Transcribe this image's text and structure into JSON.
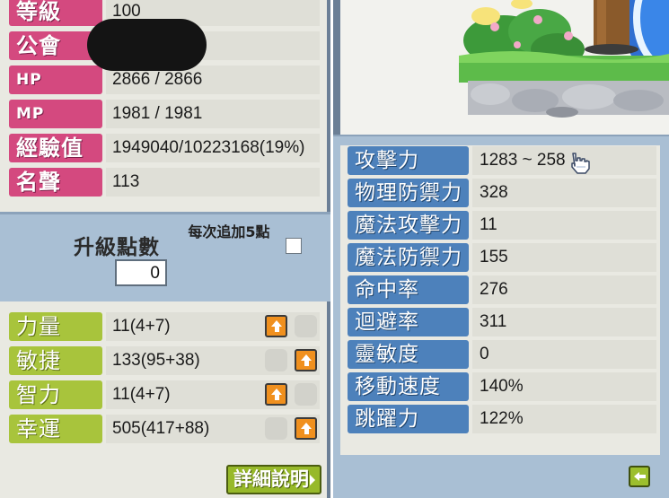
{
  "basic_stats": [
    {
      "label": "等級",
      "value": "100"
    },
    {
      "label": "公會",
      "value": ""
    },
    {
      "label": "HP",
      "value": "2866 / 2866"
    },
    {
      "label": "MP",
      "value": "1981 / 1981"
    },
    {
      "label": "經驗值",
      "value": "1949040/10223168(19%)"
    },
    {
      "label": "名聲",
      "value": "113"
    }
  ],
  "ability_points": {
    "title": "升級點數",
    "value": "0",
    "each_add_label": "每次追加5點"
  },
  "main_stats": [
    {
      "label": "力量",
      "value": "11(4+7)"
    },
    {
      "label": "敏捷",
      "value": "133(95+38)"
    },
    {
      "label": "智力",
      "value": "11(4+7)"
    },
    {
      "label": "幸運",
      "value": "505(417+88)"
    }
  ],
  "detail_button": {
    "label": "詳細說明"
  },
  "detail_stats": [
    {
      "label": "攻擊力",
      "value": "1283 ~ 258"
    },
    {
      "label": "物理防禦力",
      "value": "328"
    },
    {
      "label": "魔法攻擊力",
      "value": "11"
    },
    {
      "label": "魔法防禦力",
      "value": "155"
    },
    {
      "label": "命中率",
      "value": "276"
    },
    {
      "label": "迴避率",
      "value": "311"
    },
    {
      "label": "靈敏度",
      "value": "0"
    },
    {
      "label": "移動速度",
      "value": "140%"
    },
    {
      "label": "跳躍力",
      "value": "122%"
    }
  ],
  "colors": {
    "basic_label": "#d4497f",
    "stat_label": "#a8c43c",
    "detail_label": "#4d81bb",
    "panel_blue": "#a9bfd4",
    "up_button": "#f0901e"
  },
  "icons": [
    "arrow-up-icon",
    "back-arrow-icon",
    "hand-cursor-icon"
  ]
}
